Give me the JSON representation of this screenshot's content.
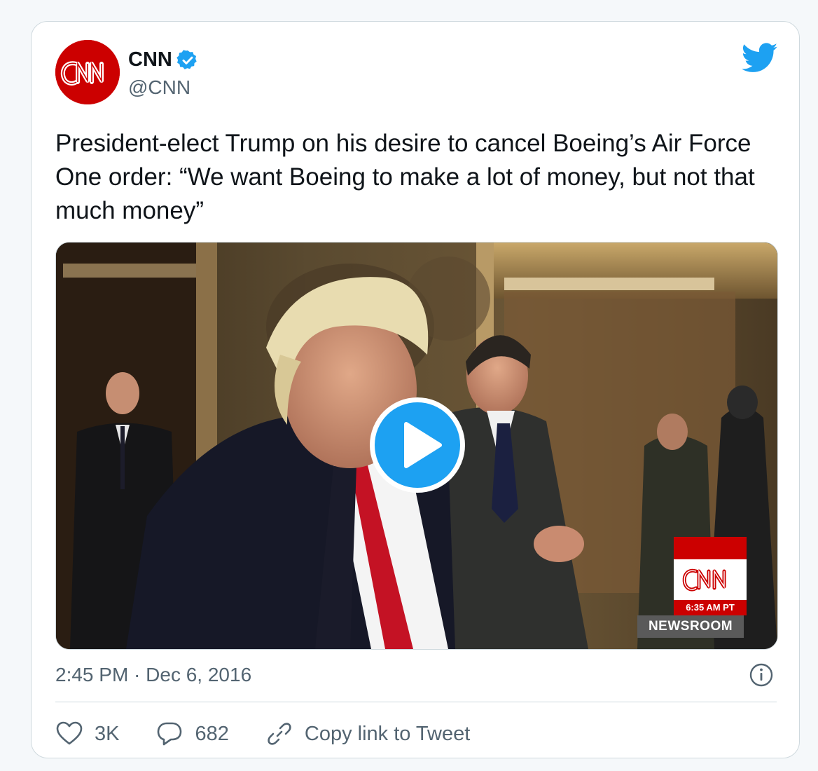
{
  "account": {
    "name": "CNN",
    "handle": "@CNN",
    "verified": true
  },
  "tweet": {
    "text": "President-elect Trump on his desire to cancel Boeing’s Air Force One order: “We want Boeing to make a lot of money, but not that much money”",
    "timestamp": "2:45 PM · Dec 6, 2016"
  },
  "video": {
    "overlay_time": "6:35 AM PT",
    "overlay_show": "NEWSROOM"
  },
  "actions": {
    "likes": "3K",
    "replies": "682",
    "copy_link_label": "Copy link to Tweet"
  },
  "icons": [
    "cnn-logo",
    "verified-badge-icon",
    "twitter-bird-icon",
    "play-icon",
    "info-icon",
    "heart-icon",
    "reply-bubble-icon",
    "link-icon"
  ],
  "colors": {
    "brand_blue": "#1da1f2",
    "cnn_red": "#cc0000",
    "text_primary": "#0f1419",
    "text_secondary": "#536471",
    "border": "#cfd9de"
  }
}
